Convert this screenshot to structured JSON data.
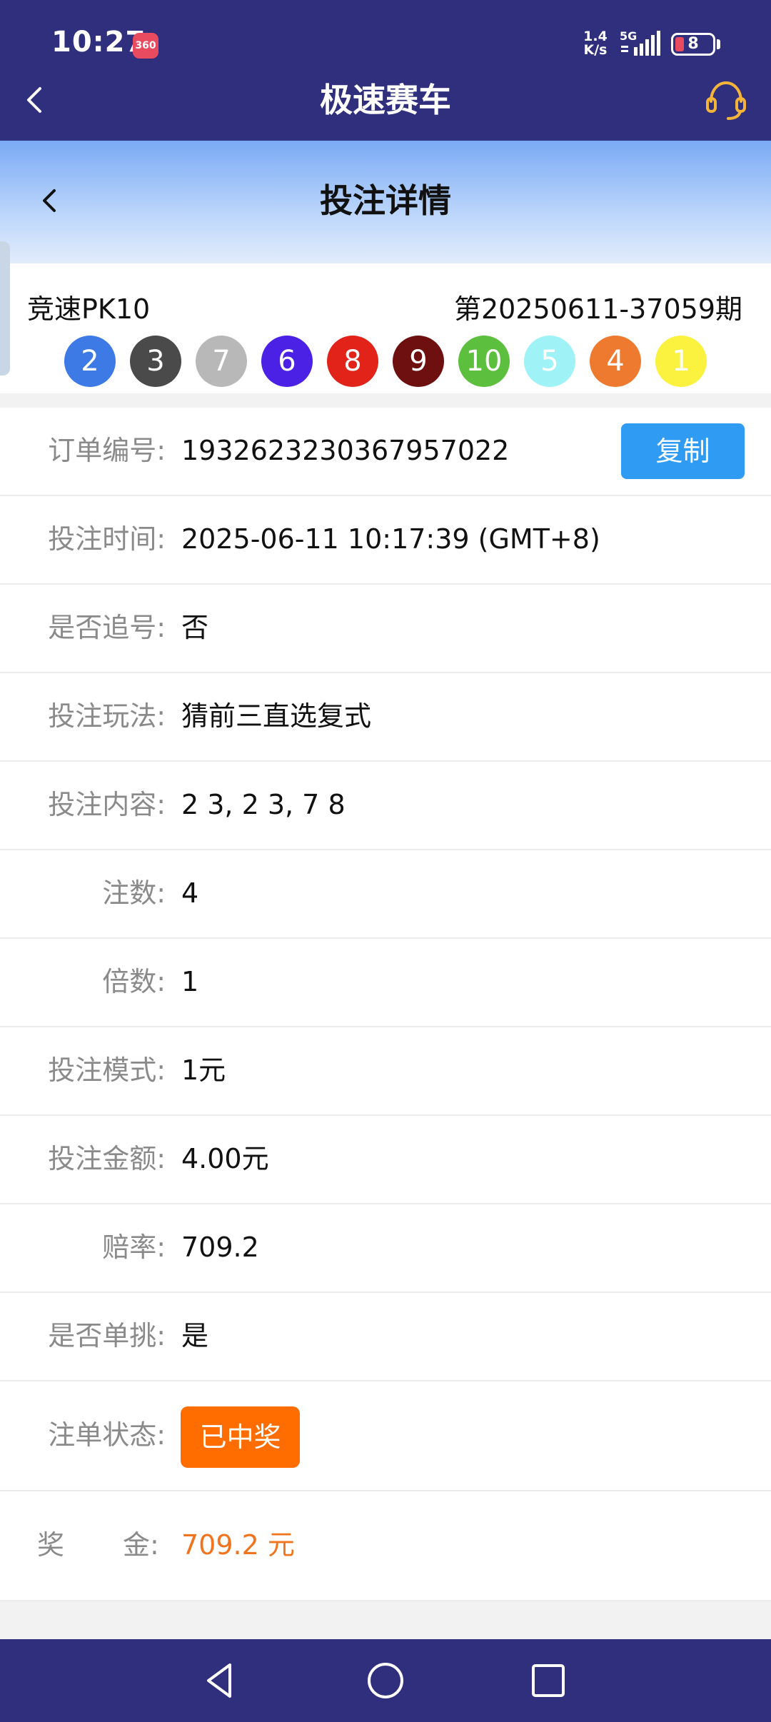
{
  "status_bar": {
    "time": "10:27",
    "app_badge": "360",
    "net_speed_value": "1.4",
    "net_speed_unit": "K/s",
    "network_type": "5G",
    "battery_level": "8",
    "battery_color": "#e84a5f"
  },
  "header": {
    "title": "极速赛车",
    "back_icon": "chevron-left-icon",
    "support_icon": "headset-icon",
    "background": "#2f2f7e"
  },
  "subheader": {
    "title": "投注详情",
    "back_icon": "chevron-left-icon"
  },
  "draw": {
    "lottery_name": "竞速PK10",
    "issue": "第20250611-37059期",
    "balls": [
      {
        "number": "2",
        "color": "#3d7ae6"
      },
      {
        "number": "3",
        "color": "#4a4a4a"
      },
      {
        "number": "7",
        "color": "#b8b8b8"
      },
      {
        "number": "6",
        "color": "#4b21e6"
      },
      {
        "number": "8",
        "color": "#e2231a"
      },
      {
        "number": "9",
        "color": "#6e1010"
      },
      {
        "number": "10",
        "color": "#5cbf3e"
      },
      {
        "number": "5",
        "color": "#9ff3f7"
      },
      {
        "number": "4",
        "color": "#ee7a30"
      },
      {
        "number": "1",
        "color": "#fbf240"
      }
    ]
  },
  "details": {
    "order_no_label": "订单编号:",
    "order_no": "1932623230367957022",
    "copy_label": "复制",
    "bet_time_label": "投注时间:",
    "bet_time": "2025-06-11 10:17:39 (GMT+8)",
    "chase_label": "是否追号:",
    "chase": "否",
    "play_label": "投注玩法:",
    "play": "猜前三直选复式",
    "content_label": "投注内容:",
    "content": "2 3, 2 3, 7 8",
    "count_label": "注数:",
    "count": "4",
    "multiple_label": "倍数:",
    "multiple": "1",
    "mode_label": "投注模式:",
    "mode": "1元",
    "amount_label": "投注金额:",
    "amount": "4.00元",
    "odds_label": "赔率:",
    "odds": "709.2",
    "single_label": "是否单挑:",
    "single": "是",
    "status_label": "注单状态:",
    "status": "已中奖",
    "prize_label_a": "奖",
    "prize_label_b": "金:",
    "prize": "709.2 元",
    "prize_color": "#f0741e",
    "status_color": "#ff6d00",
    "copy_color": "#2f9bf2"
  },
  "navbar": {
    "back_icon": "triangle-back-icon",
    "home_icon": "circle-home-icon",
    "recents_icon": "square-recents-icon"
  }
}
